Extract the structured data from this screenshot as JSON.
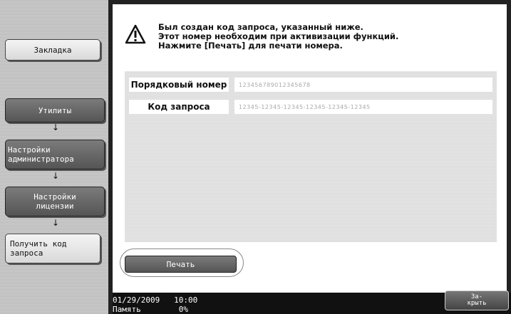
{
  "sidebar": {
    "bookmark_label": "Закладка",
    "utilities_label": "Утилиты",
    "admin_settings_label": "Настройки администратора",
    "license_settings_label": "Настройки лицензии",
    "get_request_code_label": "Получить код запроса",
    "arrow_glyph": "↓"
  },
  "message": {
    "line1": "Был создан код запроса, указанный ниже.",
    "line2": "Этот номер необходим при активизации функций.",
    "line3": "Нажмите [Печать] для печати номера."
  },
  "info": {
    "serial_label": "Порядковый номер",
    "serial_value": "123456789012345678",
    "request_label": "Код запроса",
    "request_value": "12345-12345-12345-12345-12345-12345"
  },
  "print_label": "Печать",
  "footer": {
    "datetime": "01/29/2009   10:00",
    "memory": "Память        0%"
  },
  "close_label": "За-\nкрыть"
}
